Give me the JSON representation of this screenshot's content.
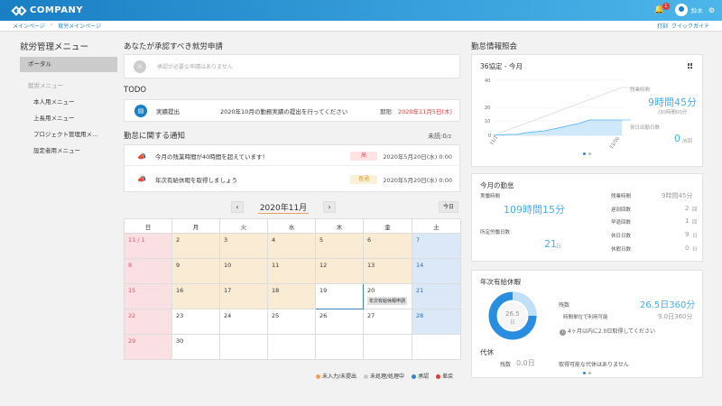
{
  "app": {
    "logo_text": "COMPANY",
    "user_name": "鈴木",
    "notif_count": "1"
  },
  "breadcrumb": [
    "メインページ",
    "就労メインページ"
  ],
  "quick": {
    "clock": "打刻",
    "guide": "クイックガイド"
  },
  "sidebar": {
    "title": "就労管理メニュー",
    "active": "ポータル",
    "sub_label": "就労メニュー",
    "items": [
      "本人用メニュー",
      "上長用メニュー",
      "プロジェクト管理用メ…",
      "設定者用メニュー"
    ]
  },
  "approvals": {
    "title": "あなたが承認すべき就労申請",
    "empty": "承認が必要な申請はありません"
  },
  "todo": {
    "title": "TODO",
    "kind": "実績提出",
    "message": "2020年10月の勤務実績の提出を行ってください",
    "deadline_label": "期限",
    "deadline": "2020年11月5日(木)"
  },
  "notices": {
    "title": "勤怠に関する通知",
    "unread_label": "未読:",
    "unread": "0",
    "unread_total": "/2",
    "items": [
      {
        "text": "今月の残業時間が40時間を超えています！",
        "priority": "高",
        "date": "2020年5月20日(水) 0:00"
      },
      {
        "text": "年次有給休暇を取得しましょう",
        "priority": "普通",
        "date": "2020年5月20日(水) 0:00"
      }
    ]
  },
  "calendar": {
    "month": "2020年11月",
    "prev": "‹",
    "next": "›",
    "today_btn": "今日",
    "weekdays": [
      "日",
      "月",
      "火",
      "水",
      "木",
      "金",
      "土"
    ],
    "event_tag": "年次有給休暇申請",
    "legend": [
      {
        "label": "未入力/未提出",
        "color": "#f0a060"
      },
      {
        "label": "未処理/処理中",
        "color": "#c8c8c8"
      },
      {
        "label": "承認",
        "color": "#3a82c8"
      },
      {
        "label": "差戻",
        "color": "#e53935"
      }
    ]
  },
  "attendance": {
    "title": "勤怠情報照会",
    "chart_title": "36協定 - 今月",
    "overtime_label": "残業時間",
    "overtime_value": "9時間45分",
    "overtime_limit": "/30時間00分",
    "holiday_label": "休日出勤日数",
    "holiday_value": "0",
    "holiday_limit": "/6回",
    "y_ticks": [
      "40",
      "20",
      "10",
      "0"
    ],
    "x_ticks": [
      "11/1",
      "11/30"
    ]
  },
  "today": {
    "title": "今月の勤怠",
    "actual_label": "実働時間",
    "actual_value": "109時間15分",
    "scheduled_label": "所定労働日数",
    "scheduled_value": "21",
    "scheduled_unit": "日",
    "rows": [
      {
        "label": "残業時間",
        "value": "9時間45分",
        "unit": ""
      },
      {
        "label": "遅刻回数",
        "value": "2",
        "unit": "回"
      },
      {
        "label": "早退回数",
        "value": "1",
        "unit": "回"
      },
      {
        "label": "休日日数",
        "value": "9",
        "unit": "日"
      },
      {
        "label": "休暇日数",
        "value": "0",
        "unit": "日"
      }
    ]
  },
  "leave": {
    "title": "年次有給休暇",
    "center_value": "26.5",
    "center_unit": "日",
    "remain_label": "残数",
    "remain_value": "26.5日360分",
    "usable_label": "時間単位で利用可能",
    "usable_value": "9.0日360分",
    "hint": "4ヶ月以内に2.0日取得してください",
    "daikyu_title": "代休",
    "daikyu_label": "残数",
    "daikyu_value": "0.0日",
    "daikyu_note": "取得可能な代休はありません"
  }
}
